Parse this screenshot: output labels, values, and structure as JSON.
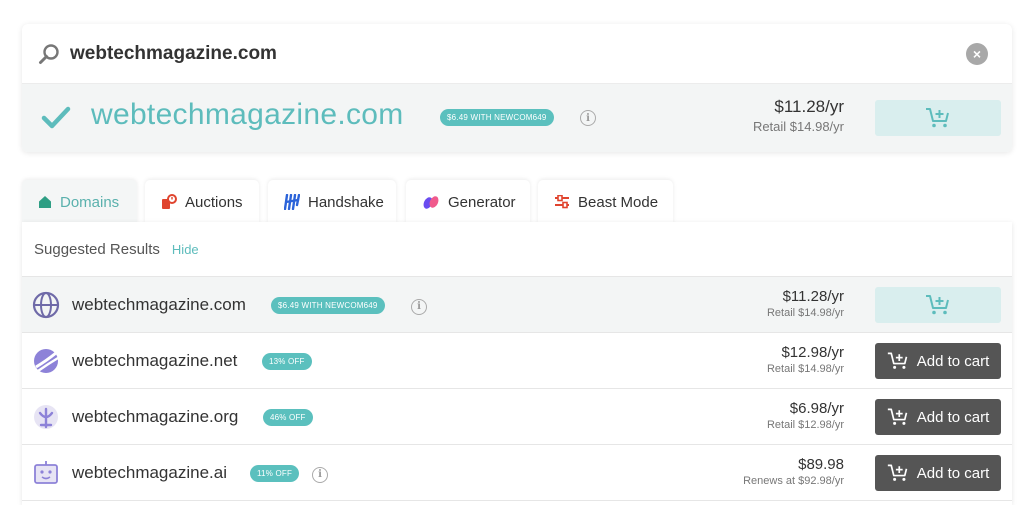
{
  "search": {
    "value": "webtechmagazine.com",
    "clear_label": "×"
  },
  "hero": {
    "domain": "webtechmagazine.com",
    "badge": "$6.49 WITH NEWCOM649",
    "price": "$11.28/yr",
    "retail": "Retail $14.98/yr",
    "status_icon": "check-icon"
  },
  "tabs": [
    {
      "label": "Domains",
      "icon": "home-icon",
      "active": true
    },
    {
      "label": "Auctions",
      "icon": "auction-icon",
      "active": false
    },
    {
      "label": "Handshake",
      "icon": "handshake-icon",
      "active": false
    },
    {
      "label": "Generator",
      "icon": "generator-icon",
      "active": false
    },
    {
      "label": "Beast Mode",
      "icon": "sliders-icon",
      "active": false
    }
  ],
  "suggested": {
    "title": "Suggested Results",
    "hide_label": "Hide"
  },
  "results": [
    {
      "domain": "webtechmagazine.com",
      "badge": "$6.49 WITH NEWCOM649",
      "info": true,
      "price": "$11.28/yr",
      "retail": "Retail $14.98/yr",
      "cart": "",
      "tld_icon": "globe-icon"
    },
    {
      "domain": "webtechmagazine.net",
      "badge": "13% OFF",
      "info": false,
      "price": "$12.98/yr",
      "retail": "Retail $14.98/yr",
      "cart": "Add to cart",
      "tld_icon": "net-icon"
    },
    {
      "domain": "webtechmagazine.org",
      "badge": "46% OFF",
      "info": false,
      "price": "$6.98/yr",
      "retail": "Retail $12.98/yr",
      "cart": "Add to cart",
      "tld_icon": "org-icon"
    },
    {
      "domain": "webtechmagazine.ai",
      "badge": "11% OFF",
      "info": true,
      "price": "$89.98",
      "retail": "Renews at $92.98/yr",
      "cart": "Add to cart",
      "tld_icon": "robot-icon"
    }
  ],
  "colors": {
    "accent": "#5dbcbc",
    "badge": "#5bc0be",
    "cart_dark": "#555555",
    "cart_light": "#d9eeee"
  }
}
